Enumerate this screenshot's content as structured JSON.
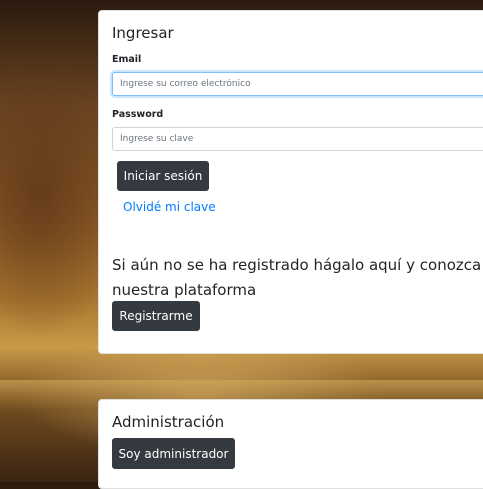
{
  "login": {
    "title": "Ingresar",
    "email_label": "Email",
    "email_placeholder": "Ingrese su correo electrónico",
    "email_value": "",
    "password_label": "Password",
    "password_placeholder": "Ingrese su clave",
    "password_value": "",
    "submit_label": "Iniciar sesión",
    "forgot_link": "Olvidé mi clave",
    "register_text": "Si aún no se ha registrado hágalo aquí y conozca nuestra plataforma",
    "register_button": "Registrarme"
  },
  "admin": {
    "title": "Administración",
    "button_label": "Soy administrador"
  },
  "colors": {
    "button_dark": "#343a40",
    "link_blue": "#007bff",
    "focus_border": "#80bdff"
  }
}
